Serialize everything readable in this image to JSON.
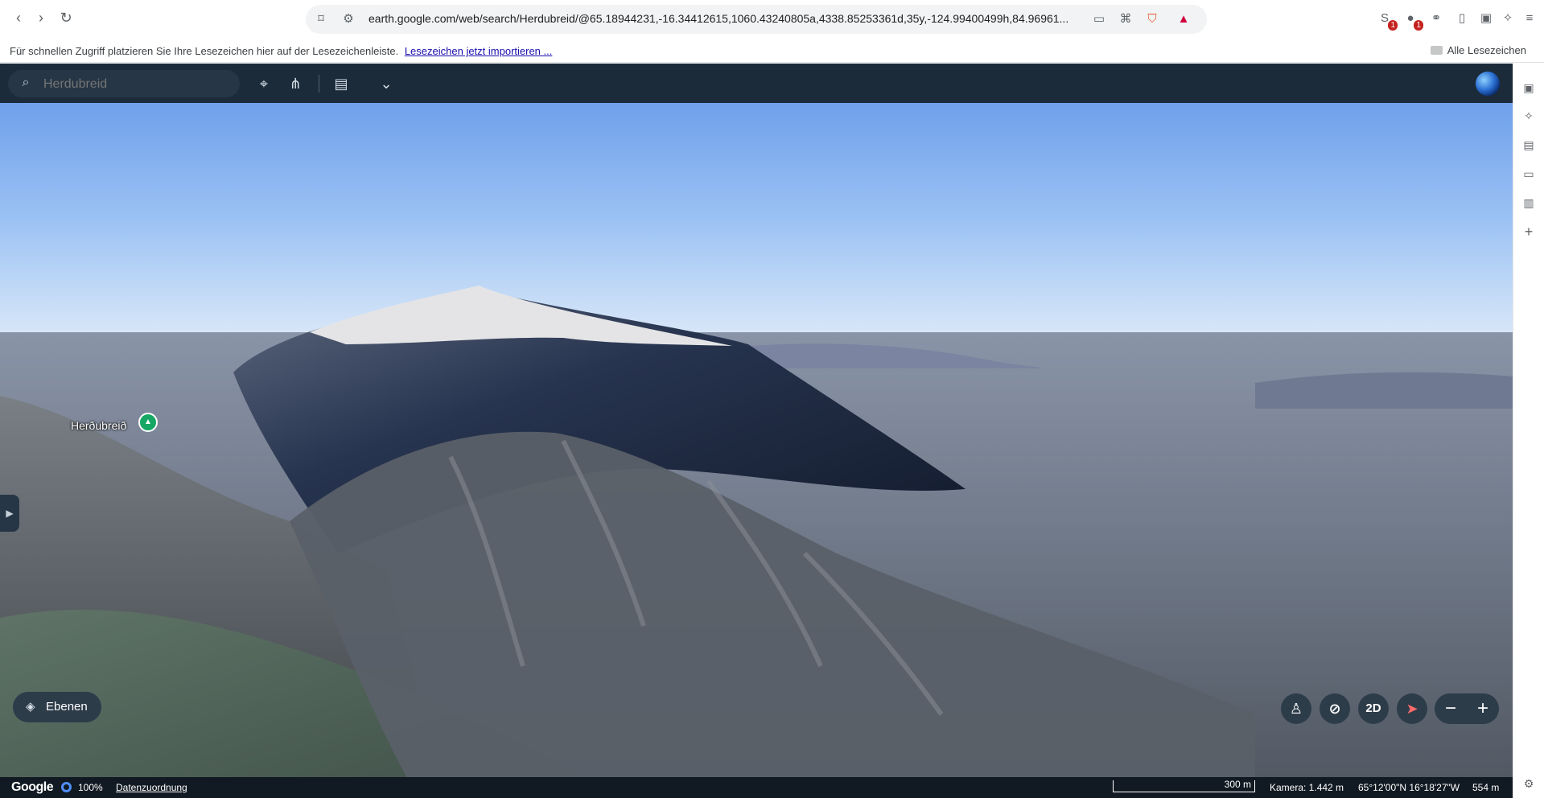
{
  "browser": {
    "url": "earth.google.com/web/search/Herdubreid/@65.18944231,-16.34412615,1060.43240805a,4338.85253361d,35y,-124.99400499h,84.96961..."
  },
  "bookmarks": {
    "prompt": "Für schnellen Zugriff platzieren Sie Ihre Lesezeichen hier auf der Lesezeichenleiste.",
    "import_link": "Lesezeichen jetzt importieren ...",
    "all": "Alle Lesezeichen"
  },
  "earth": {
    "search": {
      "value": "Herdubreid",
      "placeholder": "Herdubreid"
    },
    "map_label": "Herðubreið",
    "layers_label": "Ebenen",
    "view_mode": "2D",
    "bottom": {
      "logo": "Google",
      "quality": "100%",
      "attribution": "Datenzuordnung",
      "scale": "300 m",
      "camera": "Kamera: 1.442 m",
      "coords": "65°12'00\"N 16°18'27\"W",
      "elevation": "554 m"
    }
  },
  "extensions": {
    "badge_1": "1",
    "badge_2": "1"
  }
}
